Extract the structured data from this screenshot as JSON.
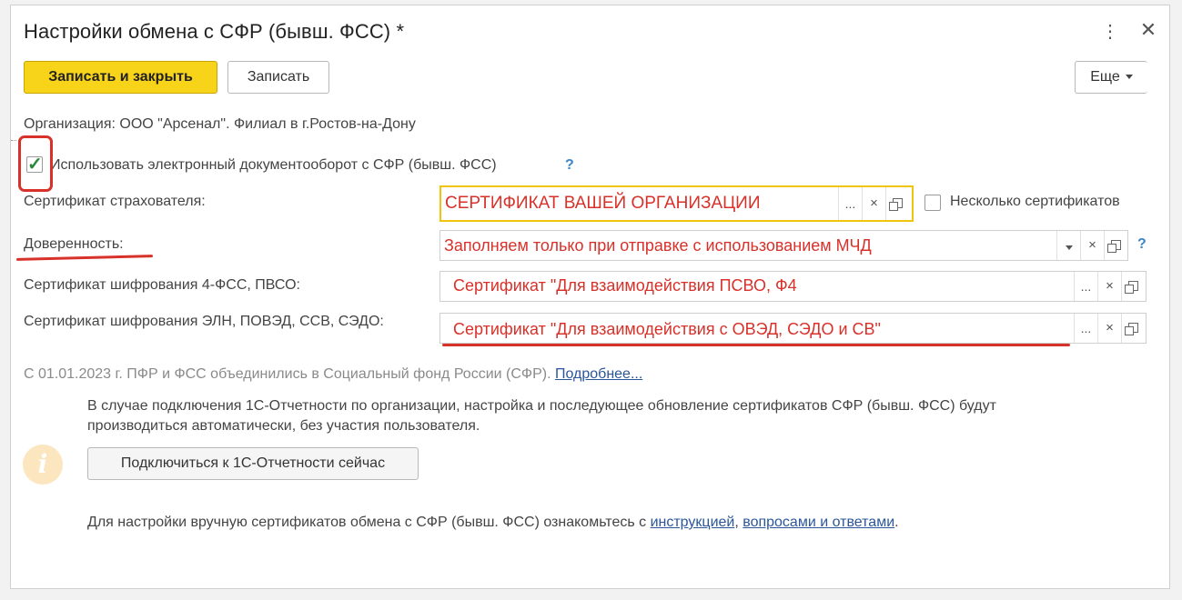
{
  "window": {
    "title": "Настройки обмена с СФР (бывш. ФСС) *"
  },
  "toolbar": {
    "save_close_label": "Записать и закрыть",
    "save_label": "Записать",
    "more_label": "Еще"
  },
  "organization_text": "Организация: ООО \"Арсенал\". Филиал в г.Ростов-на-Дону",
  "edo": {
    "checkbox_checked": true,
    "label": "Использовать электронный документооборот с СФР (бывш. ФСС)",
    "help": "?"
  },
  "fields": {
    "insurer_certificate": {
      "label": "Сертификат страхователя:",
      "value": "СЕРТИФИКАТ ВАШЕЙ ОРГАНИЗАЦИИ"
    },
    "multiple_certificates": {
      "label": "Несколько сертификатов",
      "checked": false
    },
    "power_of_attorney": {
      "label": "Доверенность:",
      "value": "Заполняем только при отправке с использованием МЧД",
      "help": "?"
    },
    "encryption_cert_4fss": {
      "label": "Сертификат шифрования 4-ФСС, ПВСО:",
      "value": "Сертификат \"Для взаимодействия ПСВО, Ф4"
    },
    "encryption_cert_eln": {
      "label": "Сертификат шифрования ЭЛН, ПОВЭД, ССВ, СЭДО:",
      "value": "Сертификат \"Для взаимодействия с ОВЭД, СЭДО и СВ\""
    }
  },
  "field_buttons": {
    "select": "...",
    "clear": "×"
  },
  "notice": {
    "text": "С 01.01.2023 г. ПФР и ФСС объединились в Социальный фонд России (СФР).",
    "link": "Подробнее..."
  },
  "info": {
    "line1": "В случае подключения 1С-Отчетности по организации, настройка и последующее обновление сертификатов СФР (бывш. ФСС) будут",
    "line2": "производиться автоматически, без участия пользователя.",
    "icon_glyph": "i",
    "connect_button": "Подключиться к 1С-Отчетности сейчас"
  },
  "manual": {
    "prefix": "Для настройки вручную сертификатов обмена с СФР (бывш. ФСС) ознакомьтесь с",
    "link1": "инструкцией",
    "separator": ",",
    "link2": "вопросами и ответами",
    "suffix": "."
  },
  "colors": {
    "primary_button": "#f7d31a",
    "annotation_red": "#d8312a",
    "link_blue": "#2b5699",
    "help_blue": "#3a86c8",
    "check_green": "#2a8a3a"
  }
}
